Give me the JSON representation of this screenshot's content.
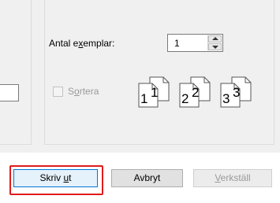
{
  "copies": {
    "label_pre": "Antal e",
    "label_mnemonic": "x",
    "label_post": "emplar:",
    "value": "1"
  },
  "collate": {
    "label_pre": "S",
    "label_mnemonic": "o",
    "label_post": "rtera",
    "checked": false,
    "enabled": false
  },
  "collate_preview": [
    {
      "big": "1",
      "small": "1"
    },
    {
      "big": "2",
      "small": "2"
    },
    {
      "big": "3",
      "small": "3"
    }
  ],
  "buttons": {
    "print_pre": "Skriv ",
    "print_mnemonic": "u",
    "print_post": "t",
    "cancel": "Avbryt",
    "apply_mnemonic": "V",
    "apply_post": "erkställ"
  },
  "colors": {
    "highlight": "#e01b1b",
    "focus_border": "#0078d7",
    "disabled_text": "#9a9a9a"
  },
  "icons": [
    "spin-up-icon",
    "spin-down-icon",
    "page-stack-icon"
  ]
}
